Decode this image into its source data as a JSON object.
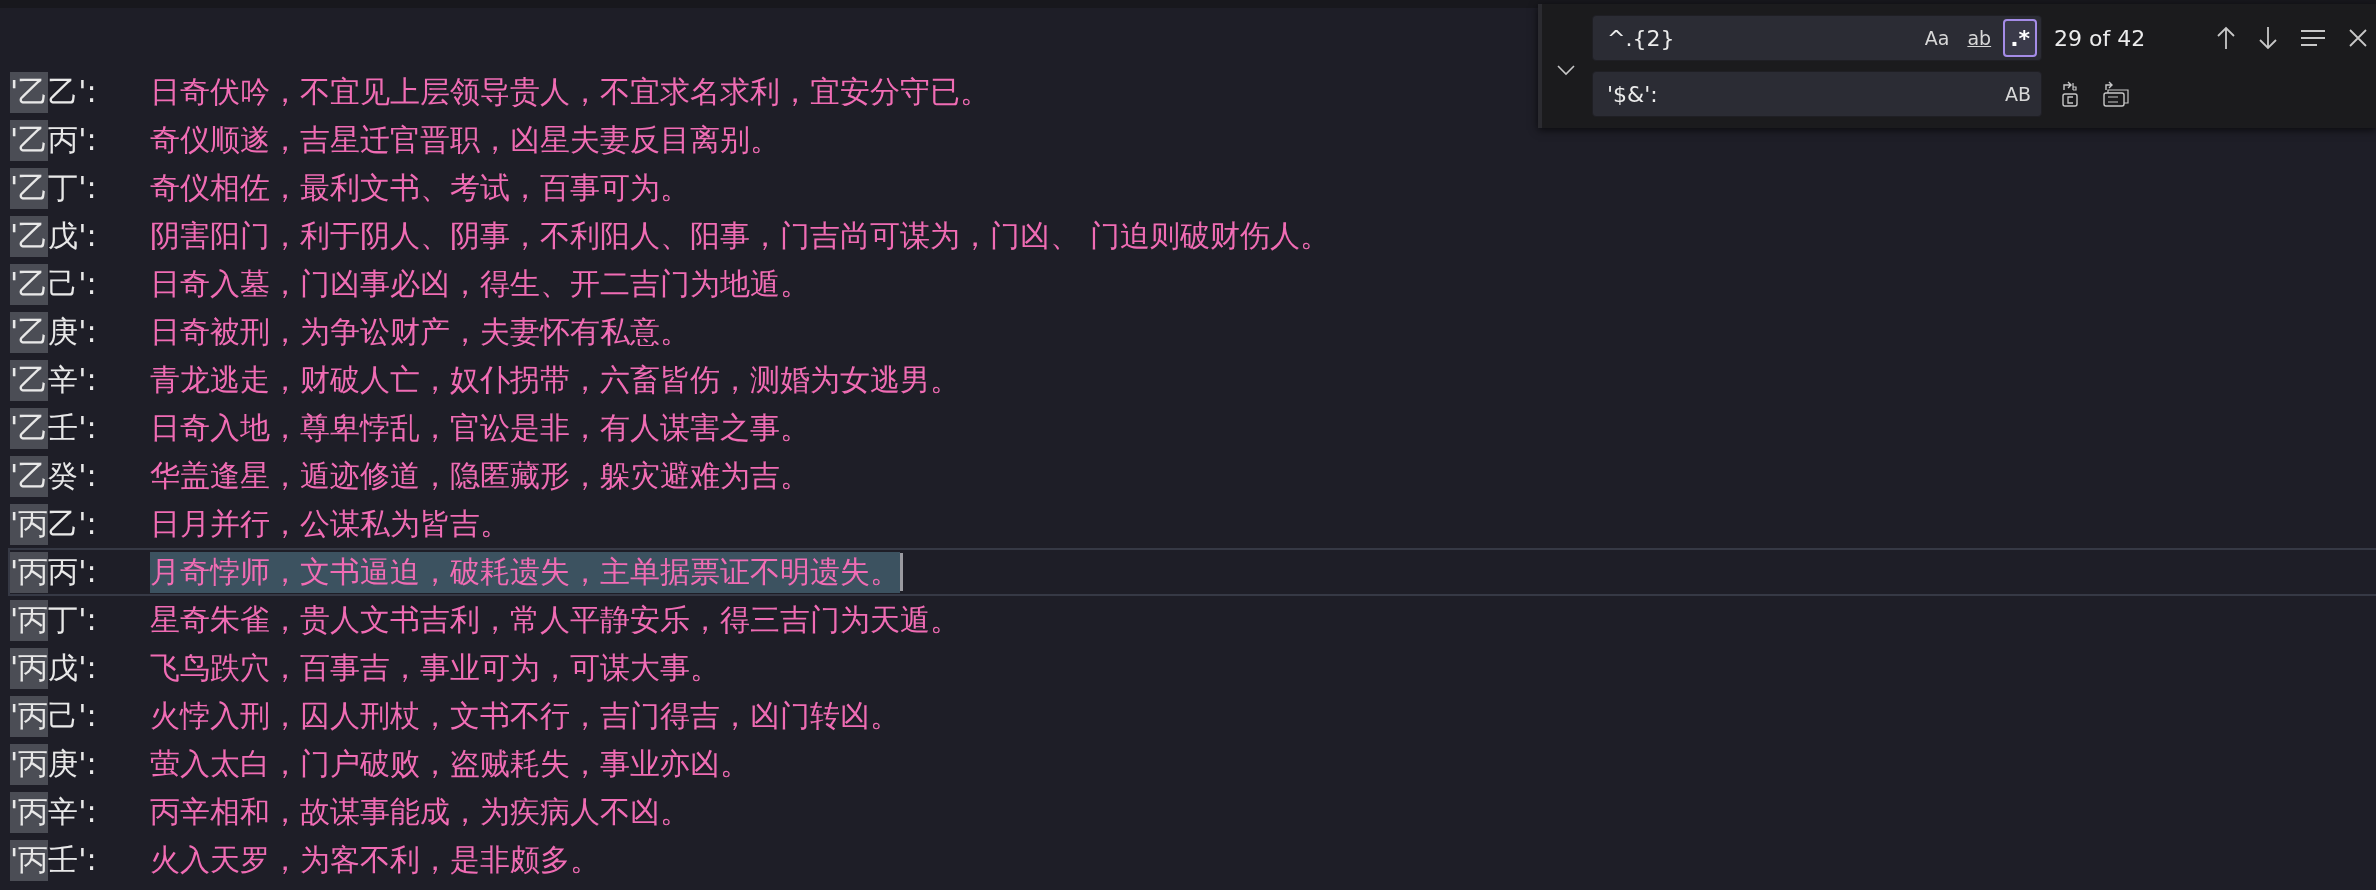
{
  "lines": [
    {
      "match": "'乙",
      "key": "乙':",
      "value": "日奇伏吟，不宜见上层领导贵人，不宜求名求利，宜安分守已。",
      "selected": false
    },
    {
      "match": "'乙",
      "key": "丙':",
      "value": "奇仪顺遂，吉星迁官晋职，凶星夫妻反目离别。",
      "selected": false
    },
    {
      "match": "'乙",
      "key": "丁':",
      "value": "奇仪相佐，最利文书、考试，百事可为。",
      "selected": false
    },
    {
      "match": "'乙",
      "key": "戊':",
      "value": "阴害阳门，利于阴人、阴事，不利阳人、阳事，门吉尚可谋为，门凶、    门迫则破财伤人。",
      "selected": false
    },
    {
      "match": "'乙",
      "key": "己':",
      "value": "日奇入墓，门凶事必凶，得生、开二吉门为地遁。",
      "selected": false
    },
    {
      "match": "'乙",
      "key": "庚':",
      "value": "日奇被刑，为争讼财产，夫妻怀有私意。",
      "selected": false
    },
    {
      "match": "'乙",
      "key": "辛':",
      "value": "青龙逃走，财破人亡，奴仆拐带，六畜皆伤，测婚为女逃男。",
      "selected": false
    },
    {
      "match": "'乙",
      "key": "壬':",
      "value": "日奇入地，尊卑悖乱，官讼是非，有人谋害之事。",
      "selected": false
    },
    {
      "match": "'乙",
      "key": "癸':",
      "value": "华盖逢星，遁迹修道，隐匿藏形，躲灾避难为吉。",
      "selected": false
    },
    {
      "match": "'丙",
      "key": "乙':",
      "value": "日月并行，公谋私为皆吉。",
      "selected": false
    },
    {
      "match": "'丙",
      "key": "丙':",
      "value": "月奇悖师，文书逼迫，破耗遗失，主单据票证不明遗失。",
      "selected": true
    },
    {
      "match": "'丙",
      "key": "丁':",
      "value": "星奇朱雀，贵人文书吉利，常人平静安乐，得三吉门为天遁。",
      "selected": false
    },
    {
      "match": "'丙",
      "key": "戊':",
      "value": "飞鸟跌穴，百事吉，事业可为，可谋大事。",
      "selected": false
    },
    {
      "match": "'丙",
      "key": "己':",
      "value": "火悖入刑，囚人刑杖，文书不行，吉门得吉，凶门转凶。",
      "selected": false
    },
    {
      "match": "'丙",
      "key": "庚':",
      "value": "萤入太白，门户破败，盗贼耗失，事业亦凶。",
      "selected": false
    },
    {
      "match": "'丙",
      "key": "辛':",
      "value": "丙辛相和，故谋事能成，为疾病人不凶。",
      "selected": false
    },
    {
      "match": "'丙",
      "key": "壬':",
      "value": "火入天罗，为客不利，是非颇多。",
      "selected": false
    }
  ],
  "find_widget": {
    "find_value": "^.{2}",
    "options": [
      {
        "kind": "case",
        "label": "Aa",
        "on": false
      },
      {
        "kind": "word",
        "label": "ab",
        "on": false
      },
      {
        "kind": "regex",
        "label": ".*",
        "on": true
      }
    ],
    "count": "29 of 42",
    "replace_value": "'$&':",
    "preserve_case": {
      "label": "AB",
      "on": false
    }
  }
}
